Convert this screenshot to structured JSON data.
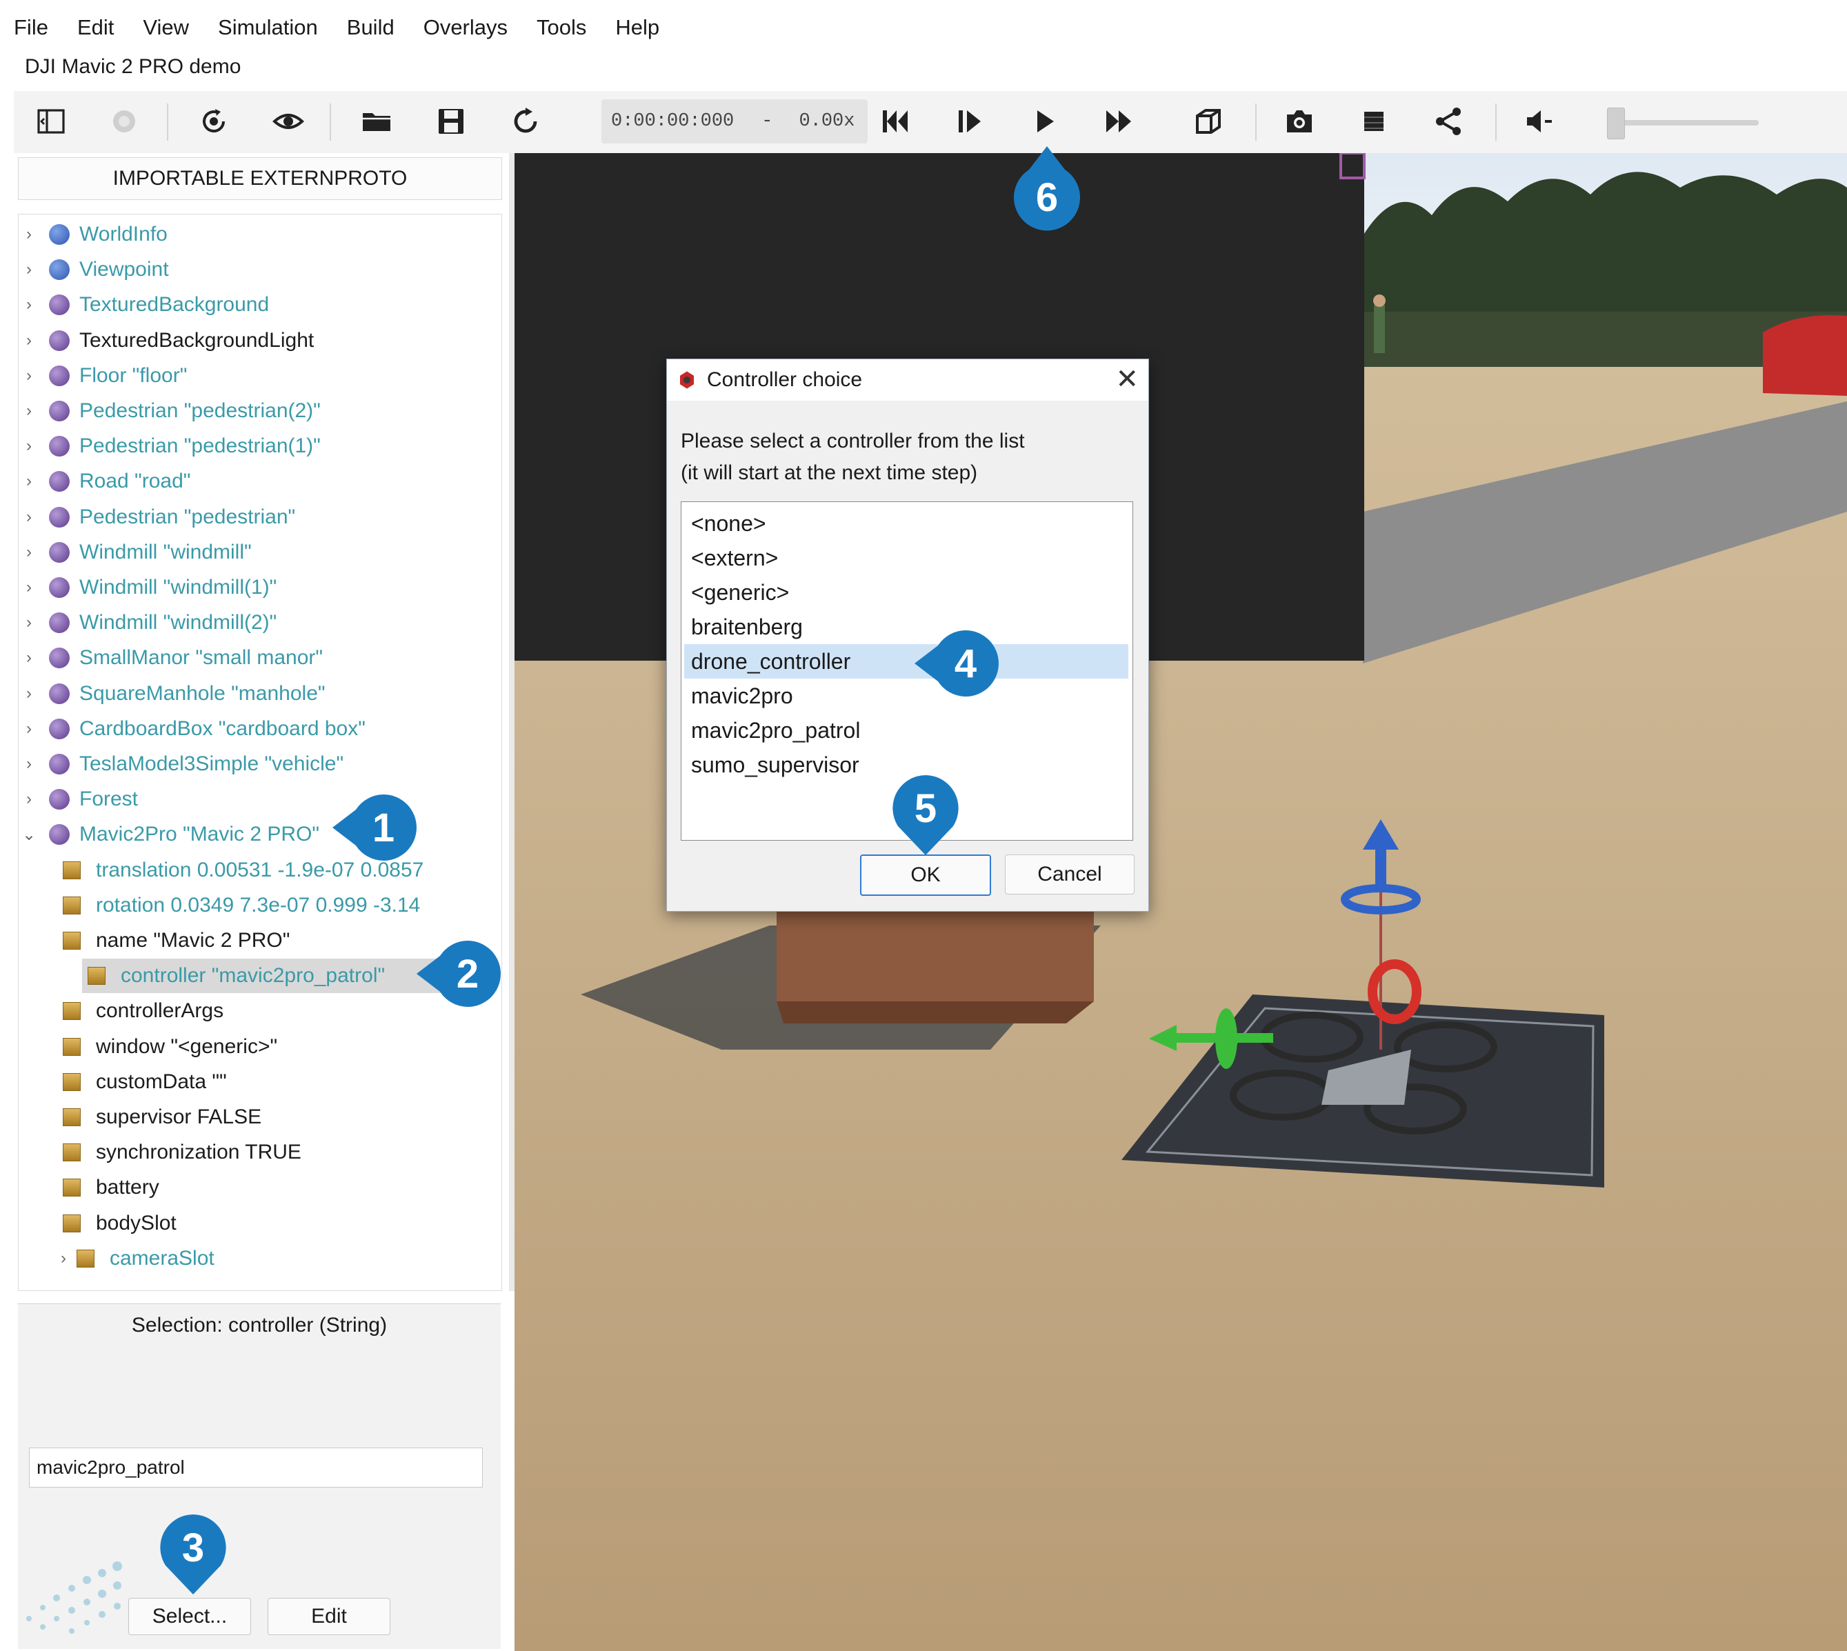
{
  "menu": [
    "File",
    "Edit",
    "View",
    "Simulation",
    "Build",
    "Overlays",
    "Tools",
    "Help"
  ],
  "window_title": "DJI Mavic 2 PRO demo",
  "toolbar": {
    "time": "0:00:00:000",
    "dash": "-",
    "speed": "0.00x",
    "icons": [
      "toggle-panel-icon",
      "record-icon",
      "reset-view-icon",
      "eye-icon",
      "open-folder-icon",
      "save-icon",
      "reload-icon",
      "skip-back-icon",
      "step-icon",
      "play-icon",
      "fast-forward-icon",
      "3d-box-icon",
      "camera-icon",
      "stop-icon",
      "share-icon",
      "volume-icon"
    ]
  },
  "left_panel": {
    "importable_label": "IMPORTABLE EXTERNPROTO",
    "tree": [
      {
        "label": "WorldInfo",
        "kind": "node",
        "icon": "blue",
        "color": "teal",
        "expanded": false
      },
      {
        "label": "Viewpoint",
        "kind": "node",
        "icon": "blue",
        "color": "teal",
        "expanded": false
      },
      {
        "label": "TexturedBackground",
        "kind": "node",
        "icon": "purple",
        "color": "teal",
        "expanded": false
      },
      {
        "label": "TexturedBackgroundLight",
        "kind": "node",
        "icon": "purple",
        "color": "dark",
        "expanded": false
      },
      {
        "label": "Floor \"floor\"",
        "kind": "node",
        "icon": "purple",
        "color": "teal",
        "expanded": false
      },
      {
        "label": "Pedestrian \"pedestrian(2)\"",
        "kind": "node",
        "icon": "purple",
        "color": "teal",
        "expanded": false
      },
      {
        "label": "Pedestrian \"pedestrian(1)\"",
        "kind": "node",
        "icon": "purple",
        "color": "teal",
        "expanded": false
      },
      {
        "label": "Road \"road\"",
        "kind": "node",
        "icon": "purple",
        "color": "teal",
        "expanded": false
      },
      {
        "label": "Pedestrian \"pedestrian\"",
        "kind": "node",
        "icon": "purple",
        "color": "teal",
        "expanded": false
      },
      {
        "label": "Windmill \"windmill\"",
        "kind": "node",
        "icon": "purple",
        "color": "teal",
        "expanded": false
      },
      {
        "label": "Windmill \"windmill(1)\"",
        "kind": "node",
        "icon": "purple",
        "color": "teal",
        "expanded": false
      },
      {
        "label": "Windmill \"windmill(2)\"",
        "kind": "node",
        "icon": "purple",
        "color": "teal",
        "expanded": false
      },
      {
        "label": "SmallManor \"small manor\"",
        "kind": "node",
        "icon": "purple",
        "color": "teal",
        "expanded": false
      },
      {
        "label": "SquareManhole \"manhole\"",
        "kind": "node",
        "icon": "purple",
        "color": "teal",
        "expanded": false
      },
      {
        "label": "CardboardBox \"cardboard box\"",
        "kind": "node",
        "icon": "purple",
        "color": "teal",
        "expanded": false
      },
      {
        "label": "TeslaModel3Simple \"vehicle\"",
        "kind": "node",
        "icon": "purple",
        "color": "teal",
        "expanded": false
      },
      {
        "label": "Forest",
        "kind": "node",
        "icon": "purple",
        "color": "teal",
        "expanded": false
      },
      {
        "label": "Mavic2Pro \"Mavic 2 PRO\"",
        "kind": "node",
        "icon": "purple",
        "color": "teal",
        "expanded": true
      },
      {
        "label": "translation 0.00531 -1.9e-07 0.0857",
        "kind": "field",
        "color": "teal"
      },
      {
        "label": "rotation 0.0349 7.3e-07 0.999 -3.14",
        "kind": "field",
        "color": "teal"
      },
      {
        "label": "name \"Mavic 2 PRO\"",
        "kind": "field",
        "color": "dark"
      },
      {
        "label": "controller \"mavic2pro_patrol\"",
        "kind": "field",
        "color": "teal",
        "selected": true
      },
      {
        "label": "controllerArgs",
        "kind": "field",
        "color": "dark"
      },
      {
        "label": "window \"<generic>\"",
        "kind": "field",
        "color": "dark"
      },
      {
        "label": "customData \"\"",
        "kind": "field",
        "color": "dark"
      },
      {
        "label": "supervisor FALSE",
        "kind": "field",
        "color": "dark"
      },
      {
        "label": "synchronization TRUE",
        "kind": "field",
        "color": "dark"
      },
      {
        "label": "battery",
        "kind": "field",
        "color": "dark"
      },
      {
        "label": "bodySlot",
        "kind": "field",
        "color": "dark"
      },
      {
        "label": "cameraSlot",
        "kind": "field",
        "color": "teal",
        "arrow": true
      }
    ],
    "selection_title": "Selection: controller (String)",
    "selection_value": "mavic2pro_patrol",
    "select_button": "Select...",
    "edit_button": "Edit"
  },
  "dialog": {
    "title": "Controller choice",
    "close": "✕",
    "message_line1": "Please select a controller from the list",
    "message_line2": "(it will start at the next time step)",
    "options": [
      "<none>",
      "<extern>",
      "<generic>",
      "braitenberg",
      "drone_controller",
      "mavic2pro",
      "mavic2pro_patrol",
      "sumo_supervisor"
    ],
    "selected": "drone_controller",
    "ok": "OK",
    "cancel": "Cancel"
  },
  "callouts": [
    "1",
    "2",
    "3",
    "4",
    "5",
    "6"
  ],
  "colors": {
    "callout": "#1a7ac0",
    "tree_teal": "#3a9aa8",
    "selection_highlight": "#cfe3f7",
    "sand": "#c7ae88",
    "wall": "#262626"
  }
}
